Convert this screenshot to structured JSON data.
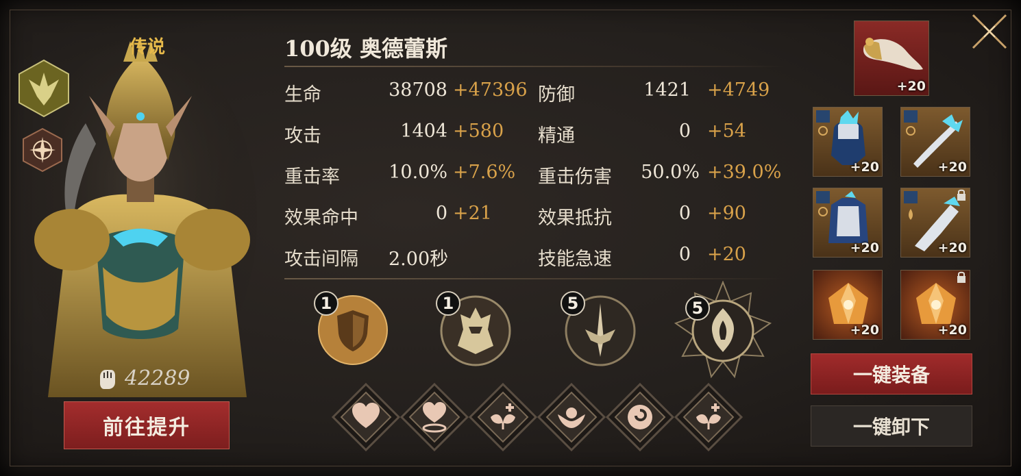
{
  "hero": {
    "rarity": "传说",
    "title": "100级 奥德蕾斯",
    "power": "42289",
    "upgrade_label": "前往提升",
    "class_icon": "winged-emblem-icon",
    "element_icon": "compass-star-icon"
  },
  "stats": [
    {
      "name": "生命",
      "base": "38708",
      "bonus": "+47396"
    },
    {
      "name": "防御",
      "base": "1421",
      "bonus": "+4749"
    },
    {
      "name": "攻击",
      "base": "1404",
      "bonus": "+580"
    },
    {
      "name": "精通",
      "base": "0",
      "bonus": "+54"
    },
    {
      "name": "重击率",
      "base": "10.0%",
      "bonus": "+7.6%"
    },
    {
      "name": "重击伤害",
      "base": "50.0%",
      "bonus": "+39.0%"
    },
    {
      "name": "效果命中",
      "base": "0",
      "bonus": "+21"
    },
    {
      "name": "效果抵抗",
      "base": "0",
      "bonus": "+90"
    },
    {
      "name": "攻击间隔",
      "value": "2.00秒"
    },
    {
      "name": "技能急速",
      "base": "0",
      "bonus": "+20"
    }
  ],
  "sets": [
    {
      "count": "1",
      "icon": "shield-medallion-icon"
    },
    {
      "count": "1",
      "icon": "helmet-medallion-icon"
    },
    {
      "count": "5",
      "icon": "sword-medallion-icon"
    },
    {
      "count": "5",
      "icon": "flame-medallion-icon"
    }
  ],
  "traits": [
    {
      "icon": "heart-icon"
    },
    {
      "icon": "heart-shield-icon"
    },
    {
      "icon": "leaf-plus-icon"
    },
    {
      "icon": "lotus-icon"
    },
    {
      "icon": "swirl-icon"
    },
    {
      "icon": "leaf-plus-icon"
    }
  ],
  "equipment": {
    "horn": {
      "level": "+20",
      "icon": "horn-icon"
    },
    "helmet": {
      "level": "+20",
      "icon": "helmet-icon"
    },
    "weapon": {
      "level": "+20",
      "icon": "blade-icon"
    },
    "armor": {
      "level": "+20",
      "icon": "armor-icon"
    },
    "gauntlet": {
      "level": "+20",
      "icon": "gauntlet-icon",
      "locked": true
    },
    "gem1": {
      "level": "+20",
      "icon": "gem-icon"
    },
    "gem2": {
      "level": "+20",
      "icon": "gem-icon",
      "locked": true
    }
  },
  "buttons": {
    "equip_all": "一键装备",
    "unequip_all": "一键卸下"
  },
  "colors": {
    "accent_gold": "#d9a24a",
    "button_red": "#a02b2b",
    "rarity_gold": "#e6b94a"
  }
}
